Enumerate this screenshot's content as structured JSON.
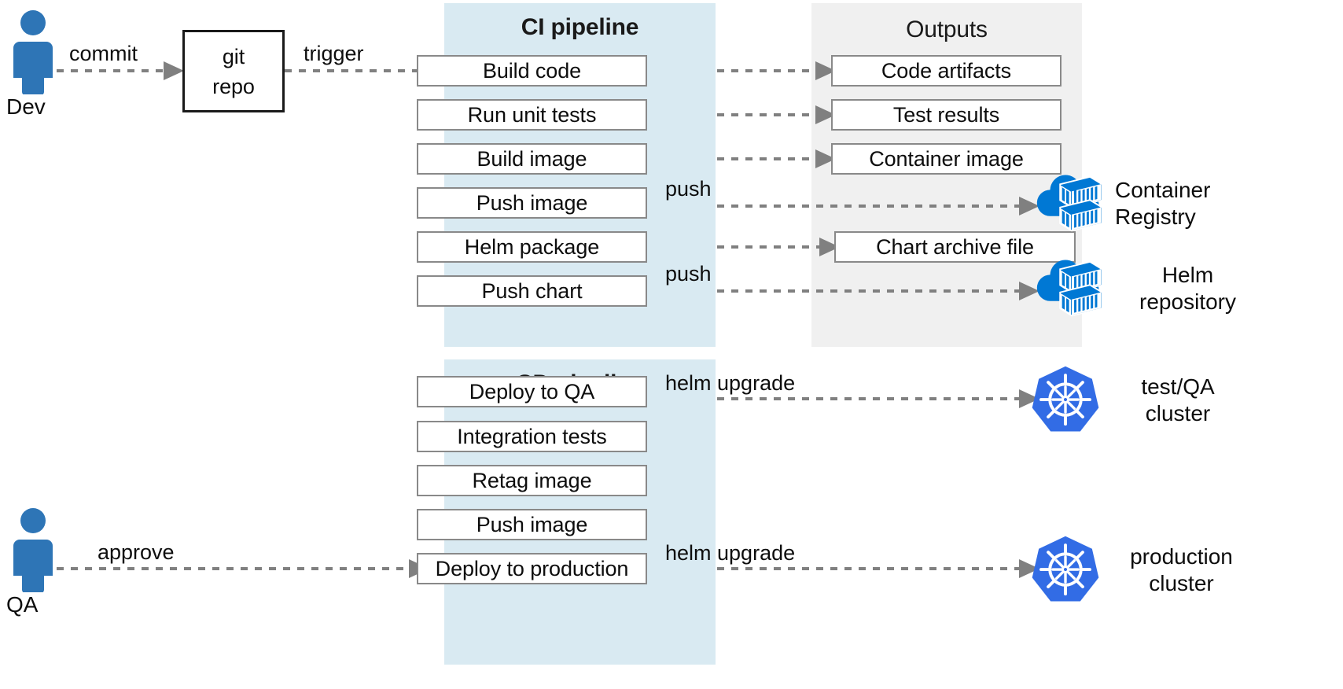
{
  "actors": [
    {
      "id": "dev",
      "label": "Dev",
      "icon": "person-icon",
      "color": "#2e75b6"
    },
    {
      "id": "qa",
      "label": "QA",
      "icon": "person-icon",
      "color": "#2e75b6"
    }
  ],
  "repo": {
    "label_line1": "git",
    "label_line2": "repo",
    "name": "git repo"
  },
  "ci_panel": {
    "title": "CI pipeline",
    "stages": [
      "Build code",
      "Run unit tests",
      "Build image",
      "Push image",
      "Helm package",
      "Push chart"
    ]
  },
  "cd_panel": {
    "title": "CD pipeline",
    "stages": [
      "Deploy to QA",
      "Integration tests",
      "Retag image",
      "Push image",
      "Deploy to production"
    ]
  },
  "outputs_panel": {
    "title": "Outputs",
    "items": [
      "Code artifacts",
      "Test results",
      "Container image",
      "Chart archive file"
    ]
  },
  "external_nodes": [
    {
      "id": "container-registry",
      "icon": "cloud-container-registry-icon",
      "label_line1": "Container",
      "label_line2": "Registry",
      "color": "#0078d4"
    },
    {
      "id": "helm-repository",
      "icon": "cloud-container-registry-icon",
      "label_line1": "Helm",
      "label_line2": "repository",
      "color": "#0078d4"
    },
    {
      "id": "test-qa-cluster",
      "icon": "kubernetes-icon",
      "label_line1": "test/QA",
      "label_line2": "cluster",
      "color": "#326ce5"
    },
    {
      "id": "production-cluster",
      "icon": "kubernetes-icon",
      "label_line1": "production",
      "label_line2": "cluster",
      "color": "#326ce5"
    }
  ],
  "edge_labels": {
    "commit": "commit",
    "trigger": "trigger",
    "push_image": "push",
    "push_chart": "push",
    "approve": "approve",
    "helm_upgrade_qa": "helm upgrade",
    "helm_upgrade_prod": "helm upgrade"
  },
  "colors": {
    "pipeline_panel": "#d9eaf2",
    "outputs_panel": "#f0f0f0",
    "box_border": "#898989",
    "box_border_dark": "#1a1a1a",
    "arrow": "#808080",
    "actor_blue": "#2e75b6",
    "azure_blue": "#0078d4",
    "k8s_blue": "#326ce5",
    "background": "#ffffff"
  }
}
